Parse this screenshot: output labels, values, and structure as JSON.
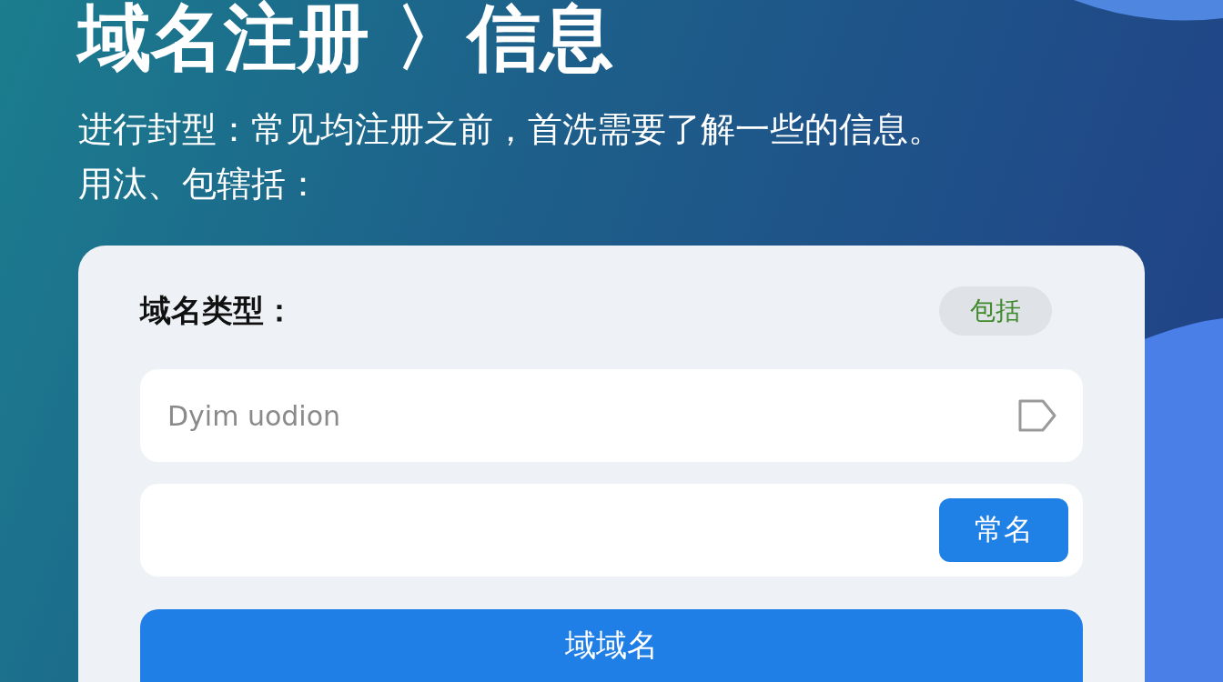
{
  "title": "域名注册 〉信息",
  "subtitle": [
    "进行封型：常见均注册之前，首洗需要了解一些的信息。",
    "用汰、包辖括："
  ],
  "card": {
    "label": "域名类型：",
    "badge": "包括",
    "domain_field": {
      "placeholder": "Dyim uodion"
    },
    "name_field": {
      "button": "常名"
    },
    "submit_button": "域域名"
  }
}
